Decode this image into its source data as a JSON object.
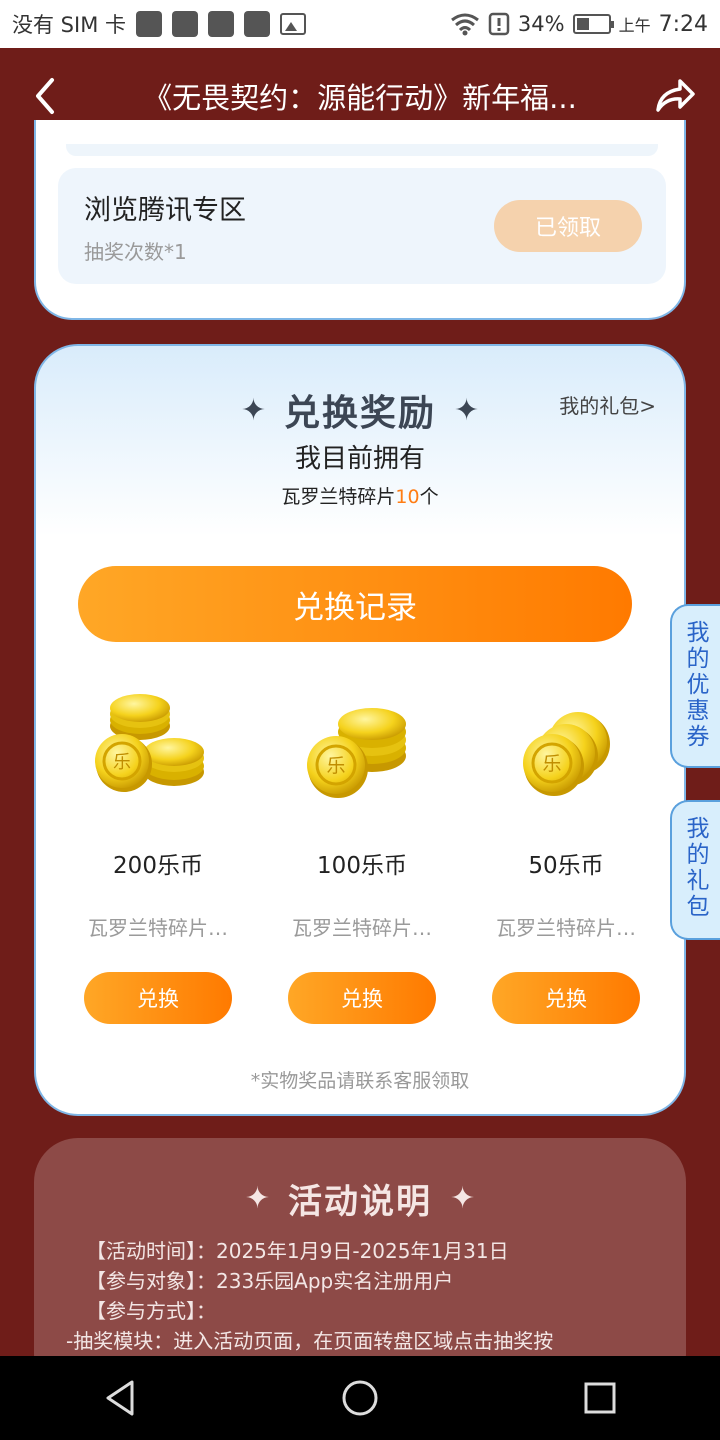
{
  "status_bar": {
    "carrier": "没有 SIM 卡",
    "battery": "34%",
    "ampm": "上午",
    "time": "7:24"
  },
  "header": {
    "title": "《无畏契约：源能行动》新年福..."
  },
  "task": {
    "name": "浏览腾讯专区",
    "reward": "抽奖次数*1",
    "button": "已领取"
  },
  "exchange": {
    "title": "兑换奖励",
    "my_gift_link": "我的礼包>",
    "own_label": "我目前拥有",
    "fragment_prefix": "瓦罗兰特碎片",
    "fragment_count": "10",
    "fragment_suffix": "个",
    "record_button": "兑换记录",
    "prizes": [
      {
        "name": "200乐币",
        "cost": "瓦罗兰特碎片…",
        "button": "兑换"
      },
      {
        "name": "100乐币",
        "cost": "瓦罗兰特碎片…",
        "button": "兑换"
      },
      {
        "name": "50乐币",
        "cost": "瓦罗兰特碎片…",
        "button": "兑换"
      }
    ],
    "note": "*实物奖品请联系客服领取",
    "coin_glyph": "乐"
  },
  "side_tabs": {
    "coupon": [
      "我",
      "的",
      "优",
      "惠",
      "券"
    ],
    "gift": [
      "我",
      "的",
      "礼",
      "包"
    ]
  },
  "rules": {
    "title": "活动说明",
    "lines": [
      "【活动时间】：2025年1月9日-2025年1月31日",
      "【参与对象】：233乐园App实名注册用户",
      "【参与方式】：",
      "-抽奖模块：进入活动页面，在页面转盘区域点击抽奖按"
    ]
  },
  "colors": {
    "background": "#6f1d19",
    "accent_orange": "#ff7a00",
    "card_border": "#7fb6e6",
    "side_tab_text": "#2a64c8"
  },
  "icons": {
    "back": "chevron-left-icon",
    "share": "share-arrow-icon",
    "nav_back": "triangle-back-icon",
    "nav_home": "circle-home-icon",
    "nav_recent": "square-recent-icon"
  }
}
